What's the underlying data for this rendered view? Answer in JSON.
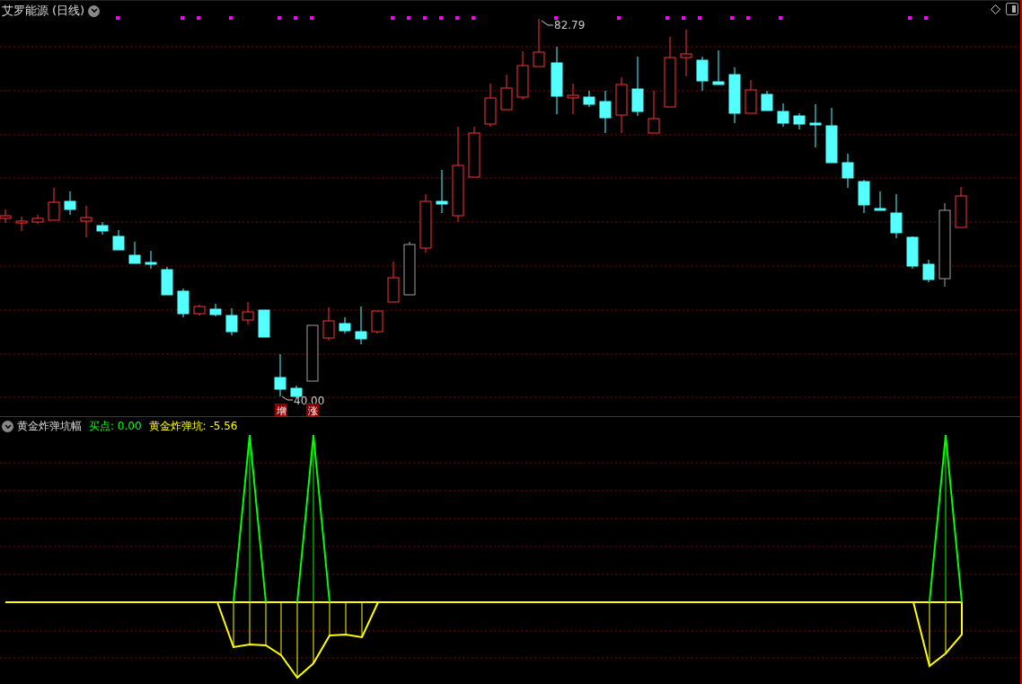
{
  "main_panel": {
    "title": "艾罗能源",
    "period": "(日线)",
    "high_label": "82.79",
    "low_label": "40.00",
    "markers": [
      "增",
      "涨"
    ]
  },
  "indicator_panel": {
    "name": "黄金炸弹坑幅",
    "readings": [
      {
        "text": "买点: 0.00",
        "color": "#00ff00"
      },
      {
        "text": "黄金炸弹坑: -5.56",
        "color": "#ffff00"
      }
    ]
  }
}
